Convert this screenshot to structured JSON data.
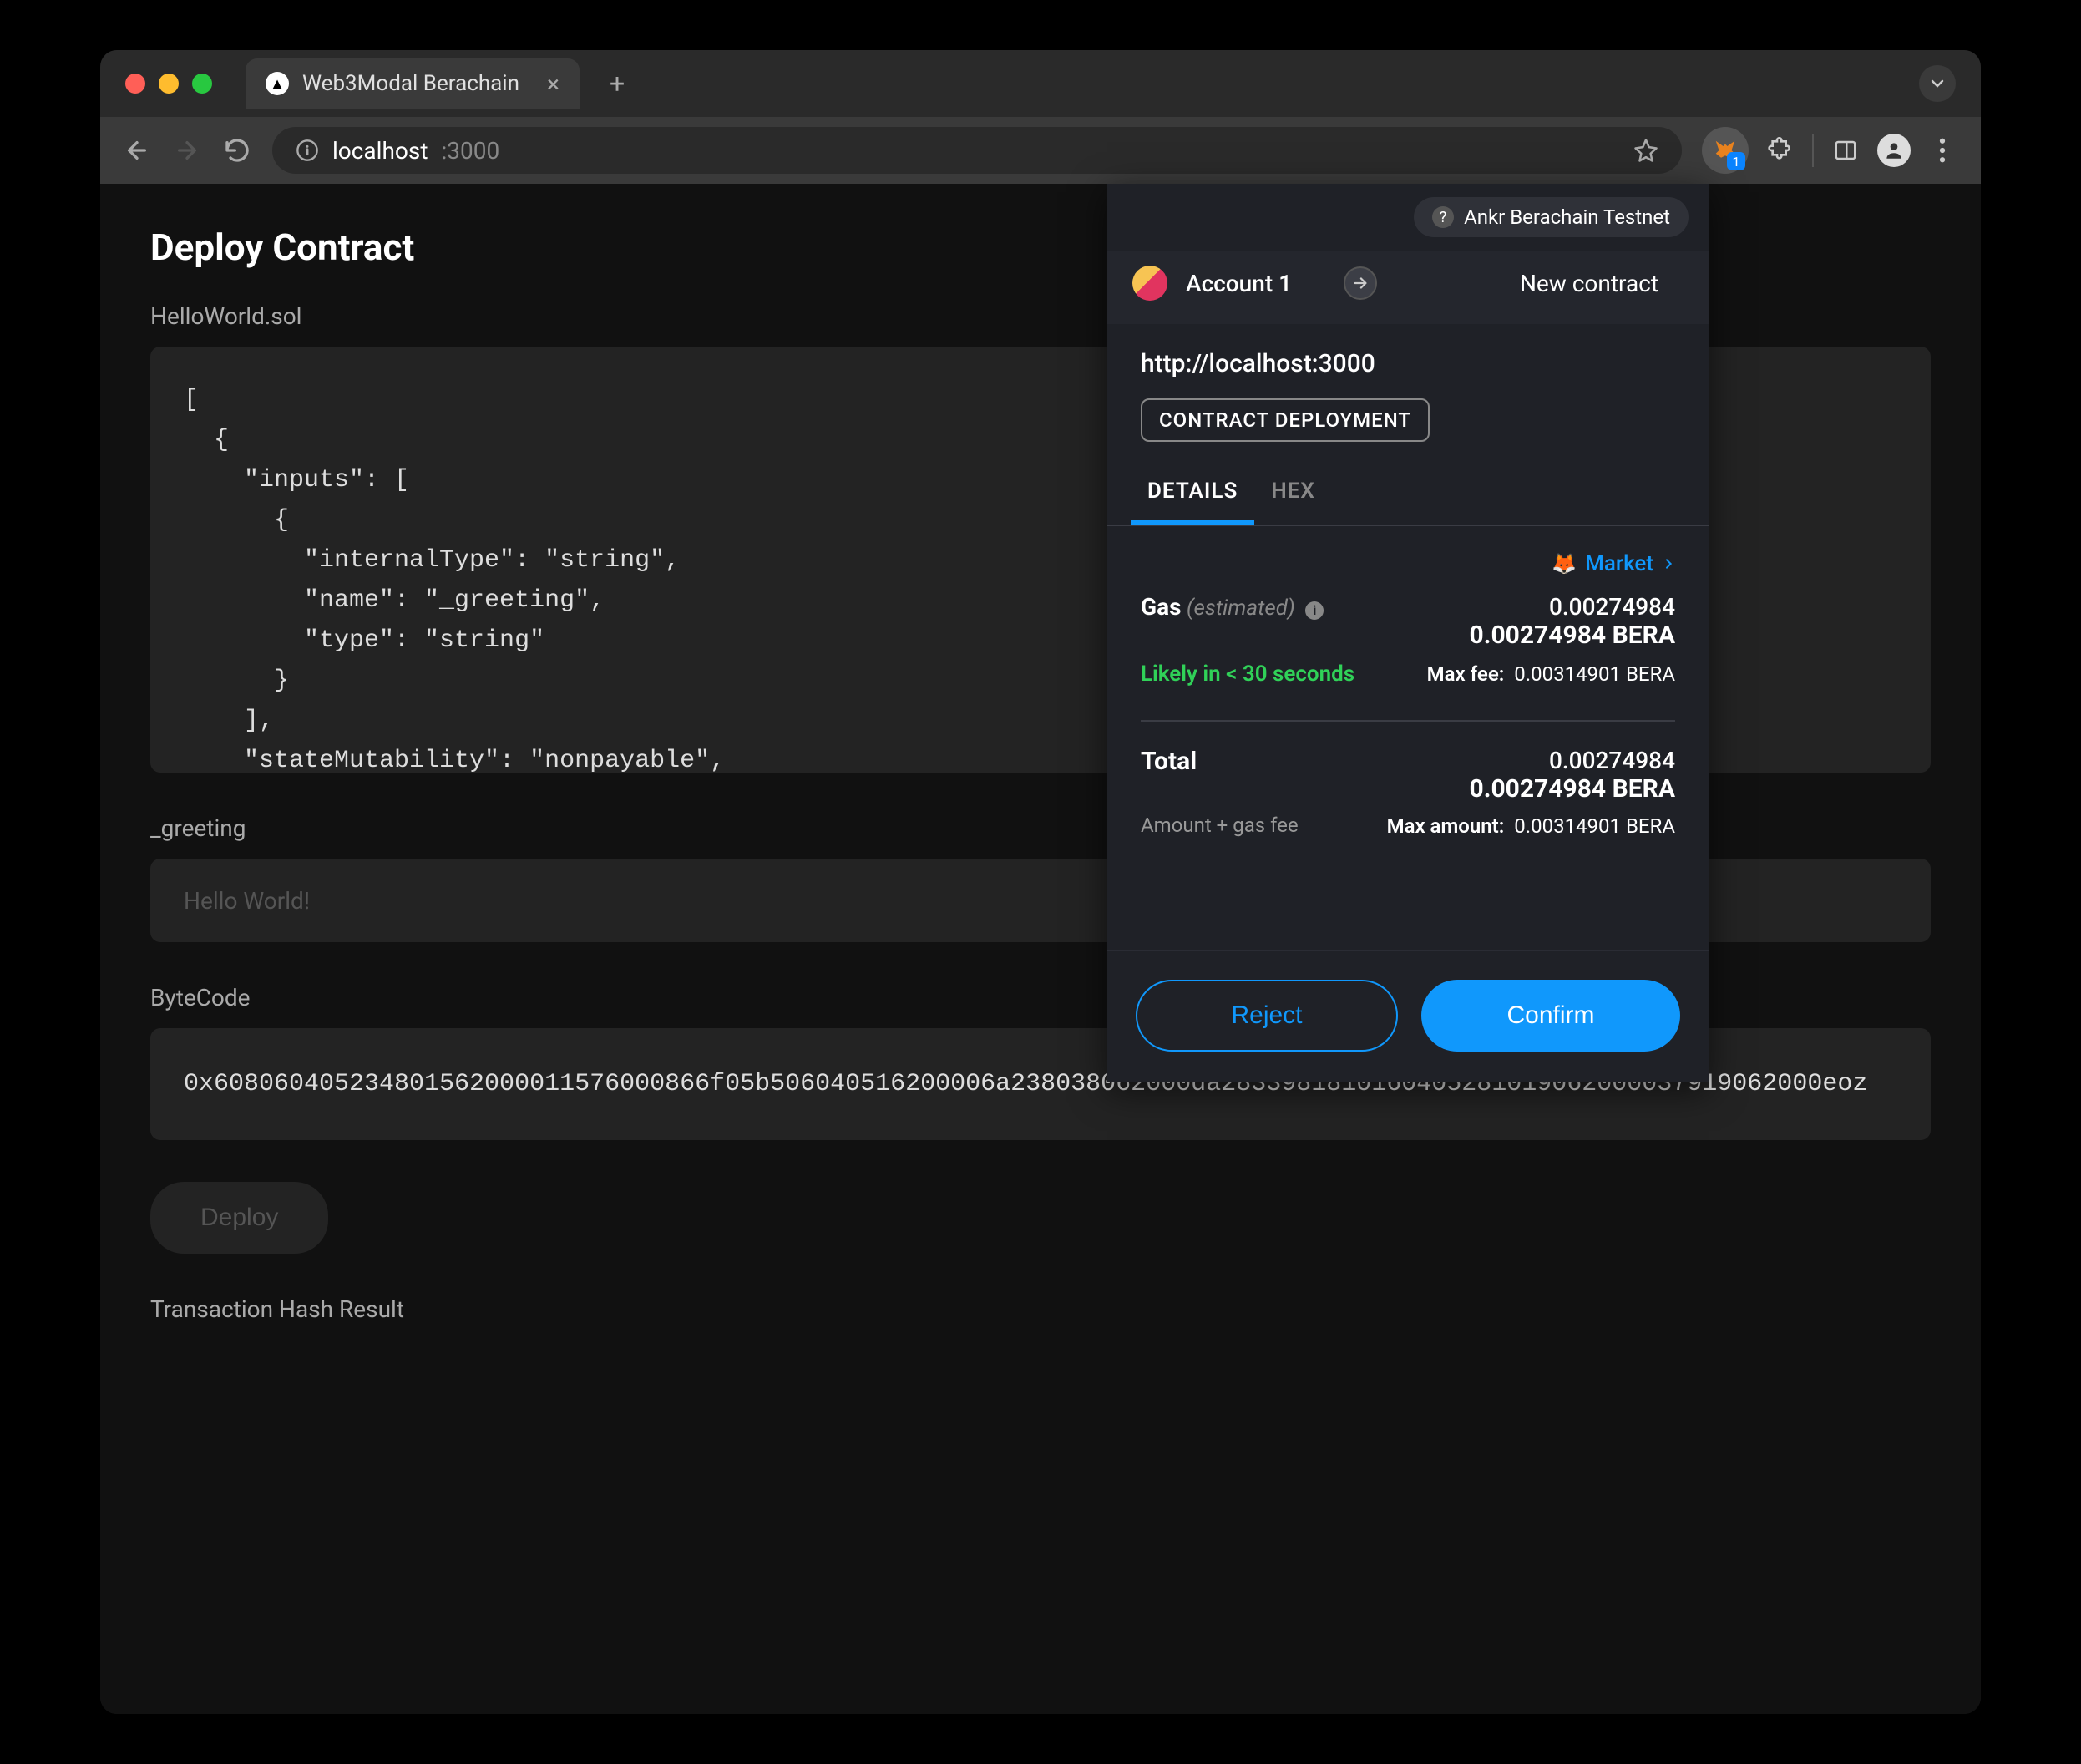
{
  "browser": {
    "tab_title": "Web3Modal Berachain",
    "url_host": "localhost",
    "url_port": ":3000",
    "ext_badge_count": "1"
  },
  "page": {
    "title": "Deploy Contract",
    "filename_label": "HelloWorld.sol",
    "code": "[\n  {\n    \"inputs\": [\n      {\n        \"internalType\": \"string\",\n        \"name\": \"_greeting\",\n        \"type\": \"string\"\n      }\n    ],\n    \"stateMutability\": \"nonpayable\",\n    \"type\": \"constructor\"",
    "greeting_label": "_greeting",
    "greeting_placeholder": "Hello World!",
    "bytecode_label": "ByteCode",
    "bytecode": "0x608060405234801562000011576000866f05b506040516200006a238038062000da2833981810160405281019062000037919062000eoz",
    "deploy_btn": "Deploy",
    "tx_hash_label": "Transaction Hash Result"
  },
  "popup": {
    "network_name": "Ankr Berachain Testnet",
    "account_name": "Account 1",
    "target": "New contract",
    "origin_url": "http://localhost:3000",
    "badge": "CONTRACT DEPLOYMENT",
    "tabs": {
      "details": "DETAILS",
      "hex": "HEX"
    },
    "market_link": "Market",
    "gas": {
      "label": "Gas",
      "estimated": "(estimated)",
      "amount1": "0.00274984",
      "amount_bold": "0.00274984 BERA",
      "likely": "Likely in < 30 seconds",
      "maxfee_label": "Max fee:",
      "maxfee_value": "0.00314901 BERA"
    },
    "total": {
      "label": "Total",
      "amount1": "0.00274984",
      "amount_bold": "0.00274984 BERA",
      "sub": "Amount + gas fee",
      "maxamt_label": "Max amount:",
      "maxamt_value": "0.00314901 BERA"
    },
    "reject": "Reject",
    "confirm": "Confirm"
  }
}
